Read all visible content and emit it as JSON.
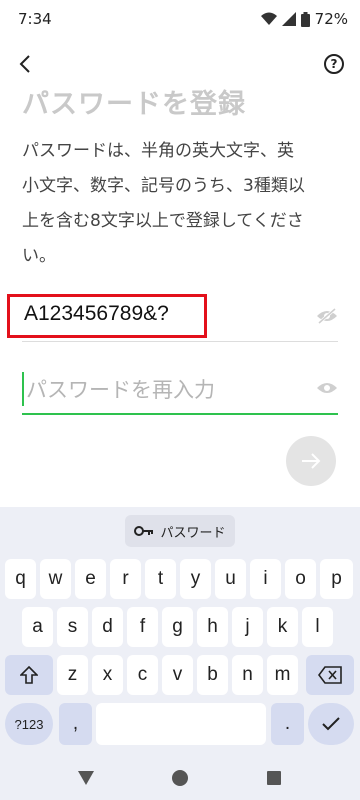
{
  "status_bar": {
    "time": "7:34",
    "battery": "72%"
  },
  "header": {
    "title": "パスワードを登録",
    "help_label": "?"
  },
  "description_lines": [
    "パスワードは、半角の英大文字、英",
    "小文字、数字、記号のうち、3種類以",
    "上を含む8文字以上で登録してくださ",
    "い。"
  ],
  "password_field": {
    "value": "A123456789&?"
  },
  "confirm_field": {
    "placeholder": "パスワードを再入力"
  },
  "keyboard": {
    "suggestion": "パスワード",
    "rows": [
      [
        "q",
        "w",
        "e",
        "r",
        "t",
        "y",
        "u",
        "i",
        "o",
        "p"
      ],
      [
        "a",
        "s",
        "d",
        "f",
        "g",
        "h",
        "j",
        "k",
        "l"
      ],
      [
        "z",
        "x",
        "c",
        "v",
        "b",
        "n",
        "m"
      ]
    ],
    "symbols_label": "?123",
    "comma": ",",
    "period": "."
  },
  "colors": {
    "accent_green": "#2ec24e",
    "highlight_red": "#e3101b"
  }
}
